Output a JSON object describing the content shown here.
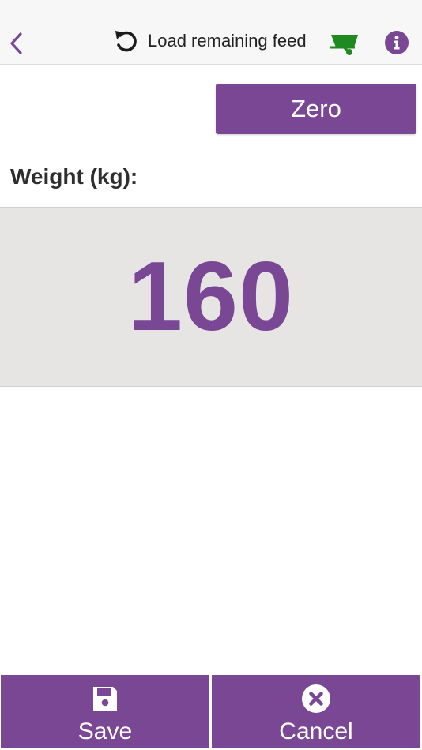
{
  "header": {
    "title": "Load remaining feed"
  },
  "zero_button": {
    "label": "Zero"
  },
  "weight": {
    "label": "Weight (kg):",
    "value": "160"
  },
  "footer": {
    "save_label": "Save",
    "cancel_label": "Cancel"
  },
  "icons": {
    "back": "chevron-left-icon",
    "reload": "reload-icon",
    "cart": "wheelbarrow-icon",
    "info": "info-icon",
    "save": "floppy-disk-icon",
    "cancel": "circle-x-icon"
  },
  "colors": {
    "accent": "#7a4795",
    "cart": "#1f8a1f",
    "weight_panel_bg": "#e6e5e4",
    "header_bg": "#f7f7f8"
  }
}
